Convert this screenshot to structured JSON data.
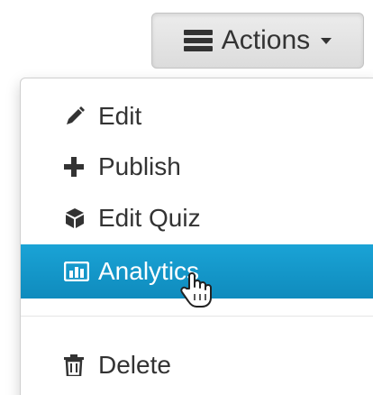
{
  "actions_button": {
    "label": "Actions",
    "icon": "list-icon",
    "caret": "caret-down-icon"
  },
  "menu": {
    "items": [
      {
        "label": "Edit",
        "icon": "pencil-icon",
        "state": "normal"
      },
      {
        "label": "Publish",
        "icon": "plus-icon",
        "state": "normal"
      },
      {
        "label": "Edit Quiz",
        "icon": "cube-icon",
        "state": "normal"
      },
      {
        "label": "Analytics",
        "icon": "bar-chart-icon",
        "state": "hover"
      },
      {
        "label": "Delete",
        "icon": "trash-icon",
        "state": "normal"
      }
    ]
  },
  "colors": {
    "highlight": "#1aa3d6",
    "text": "#333333",
    "button_bg": "#e4e4e4"
  }
}
